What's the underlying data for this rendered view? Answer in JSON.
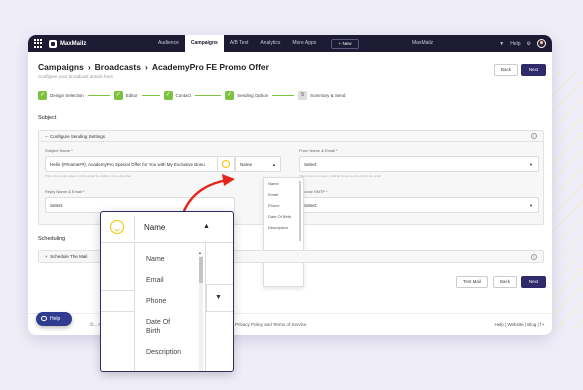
{
  "topbar": {
    "logo": "MaxMailz",
    "nav": [
      "Audience",
      "Campaigns",
      "A/B Test",
      "Analytics",
      "More Apps"
    ],
    "new_button": "New",
    "account": "MaxMailz",
    "help": "Help"
  },
  "header": {
    "crumbs": [
      "Campaigns",
      "Broadcasts",
      "AcademyPro FE Promo Offer"
    ],
    "separator": "›",
    "subtitle": "Configure your broadcast details here",
    "back": "Back",
    "next": "Next"
  },
  "steps": [
    "Design Selection",
    "Editor",
    "Contact",
    "Sending Option",
    "Summary & Send"
  ],
  "step_number": "5",
  "subject": {
    "section_title": "Subject",
    "panel_title": "Configure Sending Settings",
    "subject_label": "Subject Name *",
    "subject_value": "Hello {##name##}, AcademyPro Special Offer for You with My Exclusive Bonu",
    "subject_hint": "This is the email subject, which would be visible in the subscriber",
    "name_select": "Name",
    "from_label": "From Name & Email *",
    "from_value": "Select",
    "from_hint": "This is the from name, it will be shown as the end of the email",
    "reply_label": "Reply Name & Email *",
    "reply_value": "Select",
    "smtp_label": "Choose SMTP *",
    "smtp_value": "Select"
  },
  "mini_options": [
    "Name",
    "Email",
    "Phone",
    "Date Of Birth",
    "Description"
  ],
  "scheduling": {
    "section_title": "Scheduling",
    "panel_title": "Schedule The Mail"
  },
  "bottom_buttons": {
    "test": "Test Mail",
    "back": "Back",
    "next": "Next"
  },
  "footer": {
    "left": "©... All Rights R",
    "mid": "Privacy Policy and Terms of Service",
    "right": "Help  |  Website  |  Blog  |  f  •"
  },
  "help_pill": "Help",
  "zoom": {
    "selected": "Name",
    "options": [
      "Name",
      "Email",
      "Phone",
      "Date Of Birth",
      "Description"
    ]
  },
  "icons": {
    "caret_up": "▲",
    "caret_down": "▼",
    "check": "✓",
    "plus": "+",
    "minus": "−",
    "info": "i"
  },
  "colors": {
    "accent": "#302a6a",
    "topbar": "#1c1b33",
    "step_done": "#7cc23e",
    "highlight": "#e5241d"
  }
}
